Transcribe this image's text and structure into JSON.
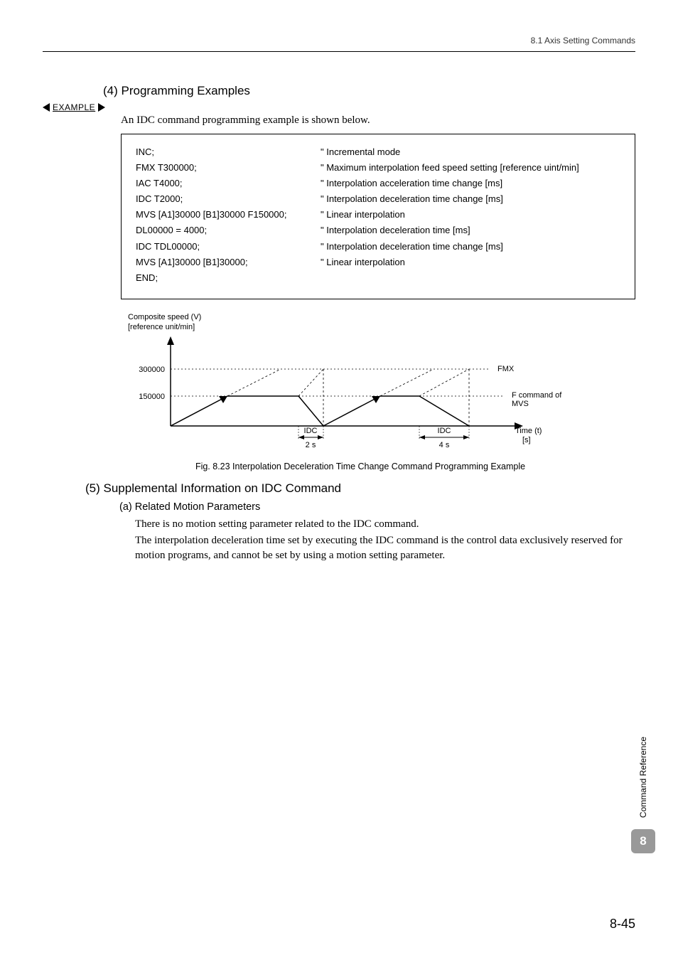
{
  "header": {
    "section_path": "8.1  Axis Setting Commands"
  },
  "h_4": "(4) Programming Examples",
  "example_label": "EXAMPLE",
  "intro": "An IDC command programming example is shown below.",
  "code": [
    {
      "l": "INC;",
      "r": "\" Incremental mode"
    },
    {
      "l": "FMX T300000;",
      "r": "\" Maximum interpolation feed speed setting [reference uint/min]"
    },
    {
      "l": "IAC T4000;",
      "r": "\" Interpolation acceleration time change [ms]"
    },
    {
      "l": "IDC T2000;",
      "r": "\" Interpolation deceleration time change [ms]"
    },
    {
      "l": "MVS [A1]30000 [B1]30000 F150000;",
      "r": "\" Linear interpolation"
    },
    {
      "l": "DL00000 = 4000;",
      "r": "\" Interpolation deceleration time [ms]"
    },
    {
      "l": "IDC TDL00000;",
      "r": "\" Interpolation deceleration time change [ms]"
    },
    {
      "l": "MVS [A1]30000 [B1]30000;",
      "r": "\" Linear interpolation"
    },
    {
      "l": "END;",
      "r": ""
    }
  ],
  "chart_data": {
    "type": "line",
    "title": "",
    "y_axis_title_lines": [
      "Composite speed (V)",
      "[reference unit/min]"
    ],
    "x_axis_title_lines": [
      "Time (t)",
      "[s]"
    ],
    "y_ticks": [
      150000,
      300000
    ],
    "reference_lines": [
      {
        "y": 300000,
        "label": "FMX"
      },
      {
        "y": 150000,
        "label": "F command of MVS"
      }
    ],
    "idc_segments": [
      {
        "label": "IDC",
        "duration_label": "2 s"
      },
      {
        "label": "IDC",
        "duration_label": "4 s"
      }
    ],
    "series": [
      {
        "name": "trapezoid1",
        "points": [
          {
            "t": 0,
            "v": 0
          },
          {
            "t": 2,
            "v": 150000
          },
          {
            "t": 5,
            "v": 150000
          },
          {
            "t": 6,
            "v": 0
          }
        ]
      },
      {
        "name": "trapezoid2",
        "points": [
          {
            "t": 6,
            "v": 0
          },
          {
            "t": 8,
            "v": 150000
          },
          {
            "t": 9,
            "v": 150000
          },
          {
            "t": 11,
            "v": 0
          }
        ]
      }
    ]
  },
  "fig_caption": "Fig. 8.23  Interpolation Deceleration Time Change Command Programming Example",
  "h_5": "(5) Supplemental Information on IDC Command",
  "sub_a": "(a) Related Motion Parameters",
  "para1": "There is no motion setting parameter related to the IDC command.",
  "para2": "The interpolation deceleration time set by executing the IDC command is the control data exclusively reserved for motion programs, and cannot be set by using a motion setting parameter.",
  "side_label": "Command Reference",
  "chapter_badge": "8",
  "page_number": "8-45"
}
